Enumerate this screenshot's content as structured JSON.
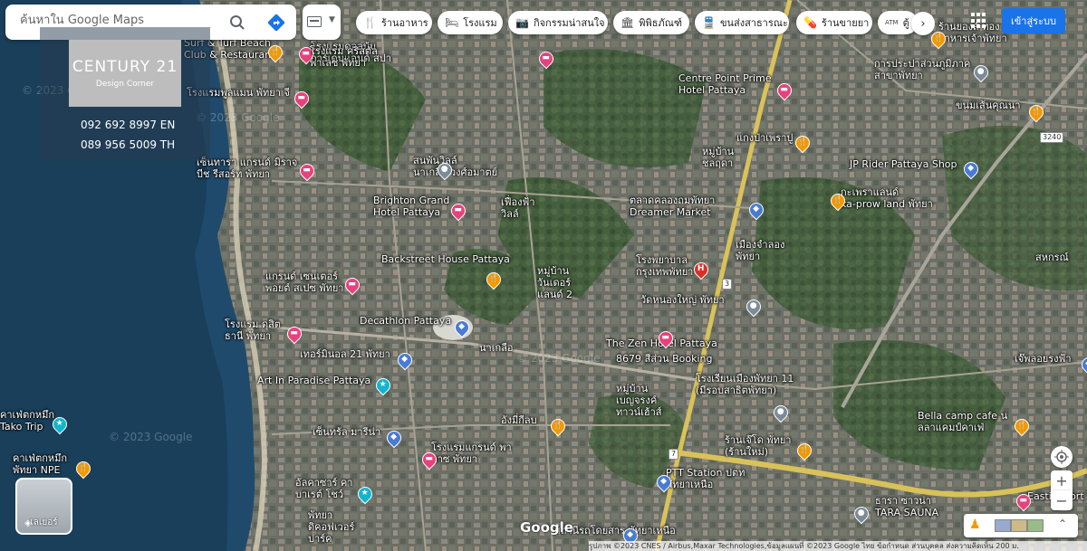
{
  "search": {
    "placeholder": "ค้นหาใน Google Maps"
  },
  "chips": [
    {
      "icon": "restaurant-icon",
      "glyph": "🍴",
      "label": "ร้านอาหาร"
    },
    {
      "icon": "hotel-icon",
      "glyph": "🛏",
      "label": "โรงแรม"
    },
    {
      "icon": "camera-icon",
      "glyph": "📷",
      "label": "กิจกรรมน่าสนใจ"
    },
    {
      "icon": "museum-icon",
      "glyph": "🏛",
      "label": "พิพิธภัณฑ์"
    },
    {
      "icon": "transit-icon",
      "glyph": "🚆",
      "label": "ขนส่งสาธารณะ"
    },
    {
      "icon": "pharmacy-icon",
      "glyph": "💊",
      "label": "ร้านขายยา"
    },
    {
      "icon": "atm-icon",
      "glyph": "ATM",
      "label": "ตู้"
    }
  ],
  "signin_label": "เข้าสู่ระบบ",
  "ad": {
    "brand": "CENTURY 21",
    "sub": "Design Corner",
    "phone_en": "092 692 8997 EN",
    "phone_th": "089 956 5009 TH"
  },
  "places": [
    {
      "name": "โรงแรมดอลบ้ม\nการ์เดนแอนด์ สปา",
      "kind": "hotel"
    },
    {
      "name": "โรงแรม คริสตัล\nพาเลซ พัทยา",
      "kind": "hotel"
    },
    {
      "name": "Surf & Turf Beach\nClub & Restaurant",
      "kind": "food"
    },
    {
      "name": "โรงแรมพูลแมน พัทยา จี",
      "kind": "hotel"
    },
    {
      "name": "Centre Point Prime\nHotel Pattaya",
      "kind": "hotel"
    },
    {
      "name": "การประปาส่วนภูมิภาค\nสาขาพัทยา",
      "kind": "gray"
    },
    {
      "name": "ขนมเส้นคุณนา",
      "kind": "food"
    },
    {
      "name": "แกงป่าเพราปู",
      "kind": "food"
    },
    {
      "name": "JP Rider Pattaya Shop",
      "kind": "shop"
    },
    {
      "name": "เซ็นทารา แกรนด์ มิราจ\nบีช รีสอร์ท พัทยา",
      "kind": "hotel"
    },
    {
      "name": "สนพันวิลล์\nนาเกลือ วงศ์อมาตย์",
      "kind": "gray"
    },
    {
      "name": "Brighton Grand\nHotel Pattaya",
      "kind": "hotel"
    },
    {
      "name": "เฟื่องฟ้า\nวิลล์",
      "kind": "none"
    },
    {
      "name": "ตลาดคลองถมพัทยา\nDreamer Market",
      "kind": "shop"
    },
    {
      "name": "กะเพราแลนด์\nka-prow land พัทยา",
      "kind": "food"
    },
    {
      "name": "Backstreet House Pattaya",
      "kind": "food"
    },
    {
      "name": "โรงพยาบาล\nกรุงเทพพัทยา",
      "kind": "red"
    },
    {
      "name": "เมืองจำลอง\nพัทยา",
      "kind": "none"
    },
    {
      "name": "แกรนด์ เซนเตอร์\nพอยต์ สเปซ พัทยา",
      "kind": "hotel"
    },
    {
      "name": "หมู่บ้าน\nวันเดอร์\nแลนด์ 2",
      "kind": "none"
    },
    {
      "name": "วัดหนองใหญ่ พัทยา",
      "kind": "gray"
    },
    {
      "name": "สหกรณ์",
      "kind": "none"
    },
    {
      "name": "โรงแรม ดุสิต\nธานี พัทยา",
      "kind": "hotel"
    },
    {
      "name": "Decathlon Pattaya",
      "kind": "shop"
    },
    {
      "name": "นาเกลือ",
      "kind": "none"
    },
    {
      "name": "The Zen Hotel Pattaya",
      "kind": "hotel"
    },
    {
      "name": "เทอร์มินอล 21 พัทยา",
      "kind": "shop"
    },
    {
      "name": "Art In Paradise Pattaya",
      "kind": "teal"
    },
    {
      "name": "โรงเรียนเมืองพัทยา 11\n(มีรอบสาธิตพัทยา)",
      "kind": "gray"
    },
    {
      "name": "เจ๊พลอยรงฟ้า",
      "kind": "shop"
    },
    {
      "name": "หมู่บ้าน\nเบญจรงค์\nทาวน์เฮ้าส์",
      "kind": "none"
    },
    {
      "name": "อังมี่กีลบ",
      "kind": "food"
    },
    {
      "name": "เซ็นทรัล มารีน่า",
      "kind": "shop"
    },
    {
      "name": "Bella camp cafe น\nลลาแคมป์คาเฟ่",
      "kind": "food"
    },
    {
      "name": "คาเฟ่ตกหมึก\nTako Trip",
      "kind": "teal"
    },
    {
      "name": "โรงแรมแกรนด์ พา\nลาซ พัทยา",
      "kind": "hotel"
    },
    {
      "name": "ร้านเจ๊โด พัทยา\n(ร้านใหม่)",
      "kind": "food"
    },
    {
      "name": "คาเฟ่ตกหมึก\nพัทยา NPE",
      "kind": "food"
    },
    {
      "name": "PTT Station ปตท\nพัทยาเหนือ",
      "kind": "shop"
    },
    {
      "name": "อัลคาซาร์ คา\nบาเรต์ โชว์",
      "kind": "teal"
    },
    {
      "name": "ธารา ซาวน่า\nTARA SAUNA",
      "kind": "gray"
    },
    {
      "name": "Easti resort",
      "kind": "hotel"
    },
    {
      "name": "พัทยา\nดิคอฟเวอร์\nปาร์ค",
      "kind": "none"
    },
    {
      "name": "สถานีรถโดยสาร พัทยาเหนือ",
      "kind": "shop"
    },
    {
      "name": "หมู่บ้าน\nชลฤดา",
      "kind": "none"
    },
    {
      "name": "ร้านยองส์ ทอง\nอาหารเจ้าพัทยา",
      "kind": "food"
    },
    {
      "name": "8679 สีส่วน Booking",
      "kind": "none"
    }
  ],
  "layers_label": "เลเยอร์",
  "google_logo": "Google",
  "attribution": "รูปภาพ ©2023 CNES / Airbus,Maxar Technologies,ข้อมูลแผนที่ ©2023 Google   ไทย   ข้อกำหนด   ส่วนบุคคล   ส่งความคิดเห็น   200 ม.",
  "watermark": "© 2023 Google",
  "route_badges": [
    "3",
    "7",
    "3240"
  ]
}
